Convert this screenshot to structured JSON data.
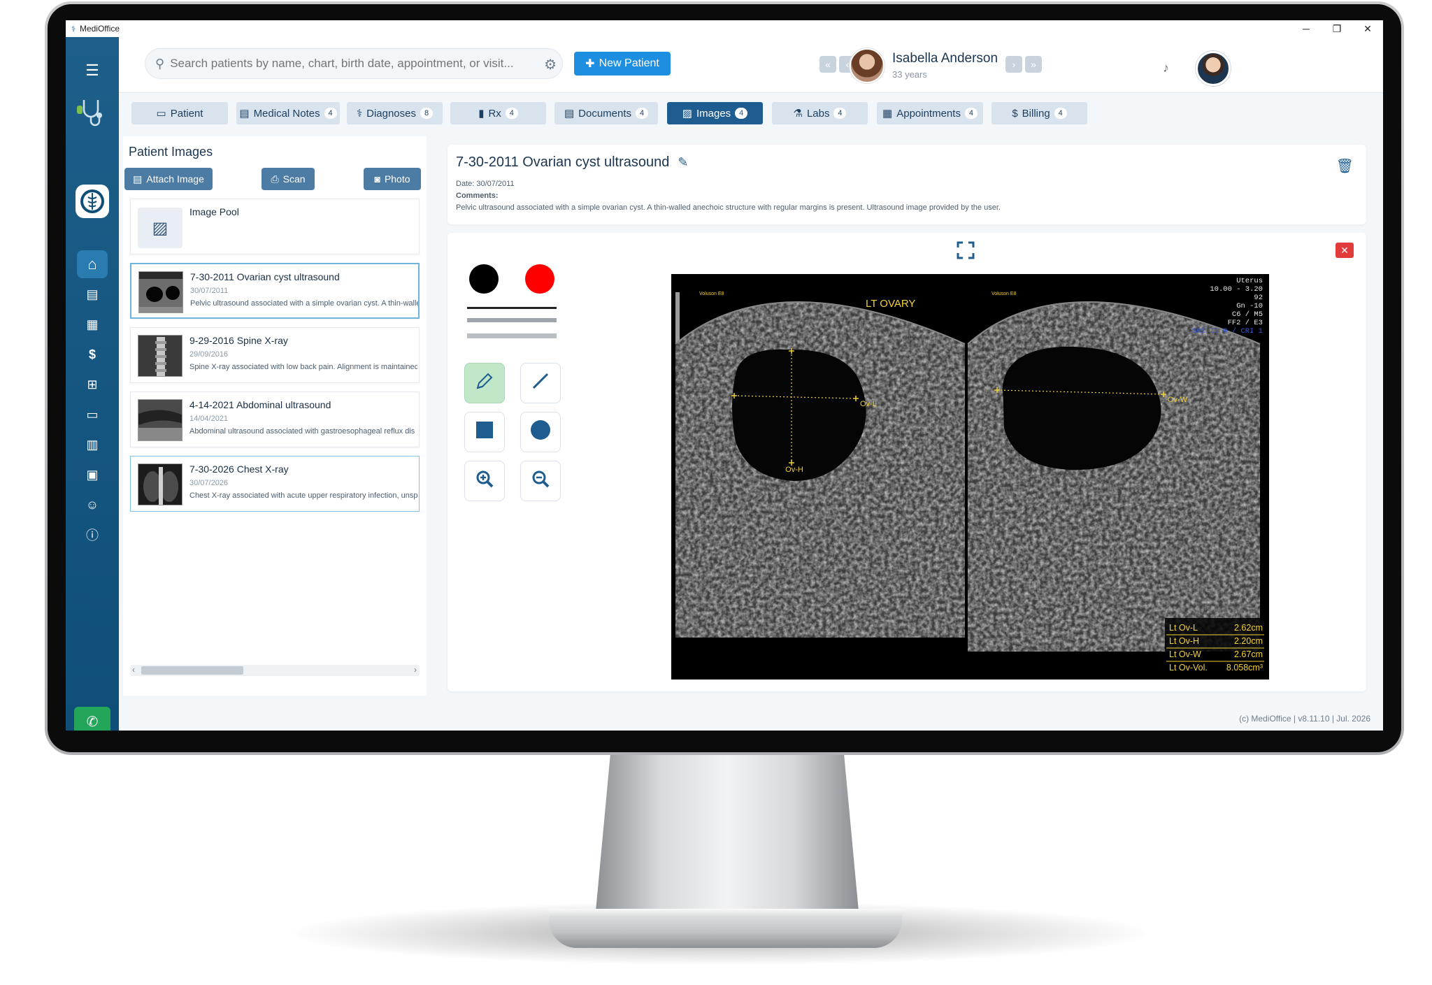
{
  "window": {
    "app_title": "MediOffice",
    "controls": [
      "─",
      "❐",
      "✕"
    ]
  },
  "sidebar": {
    "items": [
      {
        "name": "home-icon",
        "glyph": "⌂"
      },
      {
        "name": "document-icon",
        "glyph": "▤"
      },
      {
        "name": "calendar-icon",
        "glyph": "▦"
      },
      {
        "name": "dollar-icon",
        "glyph": "$"
      },
      {
        "name": "sitemap-icon",
        "glyph": "⊞"
      },
      {
        "name": "inbox-icon",
        "glyph": "▭"
      },
      {
        "name": "chart-icon",
        "glyph": "▥"
      },
      {
        "name": "lock-icon",
        "glyph": "▣"
      },
      {
        "name": "users-icon",
        "glyph": "☺"
      },
      {
        "name": "info-icon",
        "glyph": "ⓘ"
      }
    ]
  },
  "header": {
    "search_placeholder": "Search patients by name, chart, birth date, appointment, or visit...",
    "new_patient_label": "New Patient",
    "patient_name": "Isabella Anderson",
    "patient_age": "33 years"
  },
  "tabs": [
    {
      "label": "Patient",
      "count": "",
      "icon": "▭"
    },
    {
      "label": "Medical Notes",
      "count": "4",
      "icon": "▤"
    },
    {
      "label": "Diagnoses",
      "count": "8",
      "icon": "⚕"
    },
    {
      "label": "Rx",
      "count": "4",
      "icon": "▮"
    },
    {
      "label": "Documents",
      "count": "4",
      "icon": "▤"
    },
    {
      "label": "Images",
      "count": "4",
      "icon": "▨",
      "active": true
    },
    {
      "label": "Labs",
      "count": "4",
      "icon": "⚗"
    },
    {
      "label": "Appointments",
      "count": "4",
      "icon": "▦"
    },
    {
      "label": "Billing",
      "count": "4",
      "icon": "$"
    }
  ],
  "left_panel": {
    "title": "Patient Images",
    "attach_label": "Attach Image",
    "scan_label": "Scan",
    "photo_label": "Photo",
    "pool_label": "Image Pool",
    "images": [
      {
        "title": "7-30-2011 Ovarian cyst ultrasound",
        "date": "30/07/2011",
        "comment": "Pelvic ultrasound associated with a simple ovarian cyst. A thin-walle"
      },
      {
        "title": "9-29-2016 Spine X-ray",
        "date": "29/09/2016",
        "comment": "Spine X-ray associated with low back pain. Alignment is maintained"
      },
      {
        "title": "4-14-2021 Abdominal ultrasound",
        "date": "14/04/2021",
        "comment": "Abdominal ultrasound associated with gastroesophageal reflux dis"
      },
      {
        "title": "7-30-2026 Chest X-ray",
        "date": "30/07/2026",
        "comment": "Chest X-ray associated with acute upper respiratory infection, unsp"
      }
    ]
  },
  "detail": {
    "title": "7-30-2011 Ovarian cyst ultrasound",
    "date_line": "Date: 30/07/2011",
    "comments_label": "Comments:",
    "comment": "Pelvic ultrasound associated with a simple ovarian cyst. A thin-walled anechoic structure with regular margins is present. Ultrasound image provided by the user."
  },
  "ultrasound": {
    "organ_label": "LT OVARY",
    "probe_left": "Voluson E8",
    "probe_right": "Voluson E8",
    "settings": [
      "Uterus",
      "10.00 - 3.20",
      "92",
      "Gn -10",
      "C6 / M5",
      "FF2 / E3",
      "SRI II 0 / CRI 1"
    ],
    "marker_l": "Ov-L",
    "marker_h": "Ov-H",
    "marker_w": "Ov-W",
    "measurements": [
      {
        "name": "Lt Ov-L",
        "value": "2.62cm"
      },
      {
        "name": "Lt Ov-H",
        "value": "2.20cm"
      },
      {
        "name": "Lt Ov-W",
        "value": "2.67cm"
      },
      {
        "name": "Lt Ov-Vol.",
        "value": "8.058cm³"
      }
    ]
  },
  "footer": {
    "text": "(c) MediOffice  |  v8.11.10  |  Jul. 2026"
  },
  "colors": {
    "accent": "#1e8fe0",
    "sidebar": "#0e4e78",
    "active_tab": "#1f5c90",
    "call": "#23a55a",
    "swatch_black": "#000000",
    "swatch_red": "#ff0000"
  }
}
